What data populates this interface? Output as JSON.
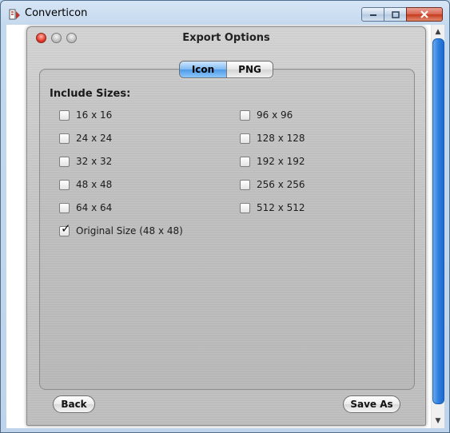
{
  "window": {
    "title": "Converticon",
    "controls": {
      "minimize": "minimize-icon",
      "maximize": "maximize-icon",
      "close": "close-icon"
    }
  },
  "sheet": {
    "title": "Export Options",
    "traffic_lights": [
      "close",
      "minimize",
      "zoom"
    ]
  },
  "tabs": [
    {
      "label": "Icon",
      "active": true
    },
    {
      "label": "PNG",
      "active": false
    }
  ],
  "include_sizes": {
    "label": "Include Sizes:",
    "left_column": [
      {
        "label": "16 x 16",
        "checked": false
      },
      {
        "label": "24 x 24",
        "checked": false
      },
      {
        "label": "32 x 32",
        "checked": false
      },
      {
        "label": "48 x 48",
        "checked": false
      },
      {
        "label": "64 x 64",
        "checked": false
      },
      {
        "label": "Original Size (48 x 48)",
        "checked": true
      }
    ],
    "right_column": [
      {
        "label": "96 x 96",
        "checked": false
      },
      {
        "label": "128 x 128",
        "checked": false
      },
      {
        "label": "192 x 192",
        "checked": false
      },
      {
        "label": "256 x 256",
        "checked": false
      },
      {
        "label": "512 x 512",
        "checked": false
      }
    ]
  },
  "buttons": {
    "back": "Back",
    "save_as": "Save As"
  },
  "colors": {
    "accent": "#4e9ae6",
    "sheet_bg": "#c6c6c6",
    "window_frame": "#bfd4ea"
  }
}
